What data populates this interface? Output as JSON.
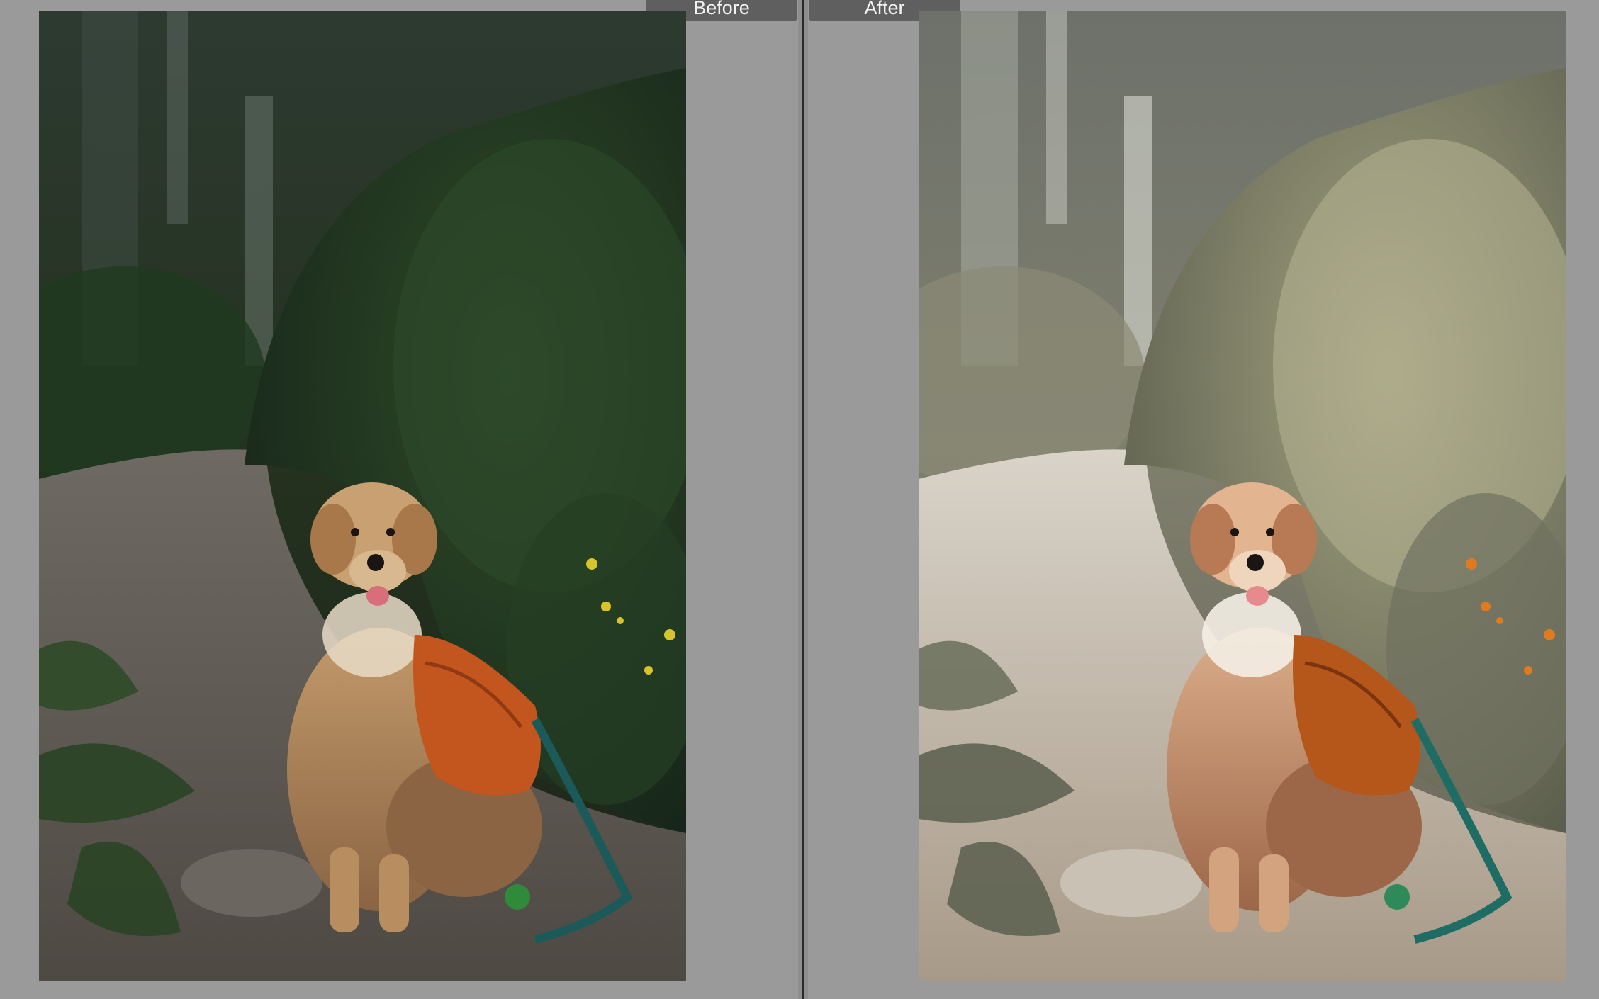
{
  "labels": {
    "before": "Before",
    "after": "After"
  },
  "colors": {
    "background": "#9a9a9a",
    "tab_background": "#5f5f5f",
    "tab_text": "#f2f2f2",
    "divider": "#2a2a2a"
  },
  "photos": {
    "before": {
      "tone": "dark-green"
    },
    "after": {
      "tone": "faded-warm"
    }
  }
}
